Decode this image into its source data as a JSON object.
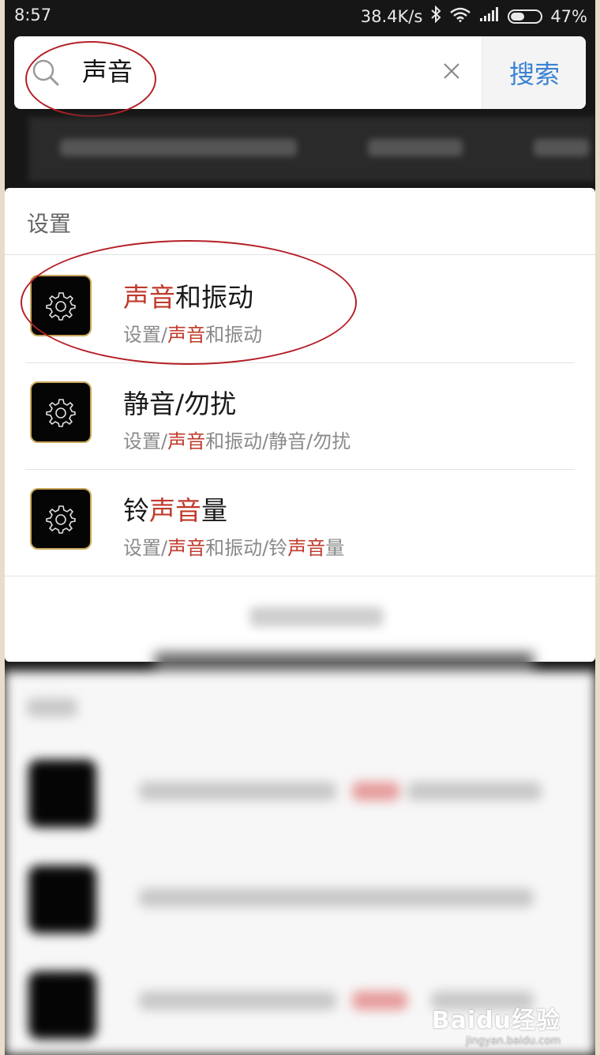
{
  "status_bar": {
    "time": "8:57",
    "network_speed": "38.4K/s",
    "battery": "47%",
    "battery_level": 0.47
  },
  "search": {
    "query": "声音",
    "button_label": "搜索"
  },
  "settings_section": {
    "header": "设置",
    "results": [
      {
        "title_parts": [
          {
            "text": "声音",
            "hl": true
          },
          {
            "text": "和振动",
            "hl": false
          }
        ],
        "path_parts": [
          {
            "text": "设置/",
            "hl": false
          },
          {
            "text": "声音",
            "hl": true
          },
          {
            "text": "和振动",
            "hl": false
          }
        ]
      },
      {
        "title_parts": [
          {
            "text": "静音/勿扰",
            "hl": false
          }
        ],
        "path_parts": [
          {
            "text": "设置/",
            "hl": false
          },
          {
            "text": "声音",
            "hl": true
          },
          {
            "text": "和振动/静音/勿扰",
            "hl": false
          }
        ]
      },
      {
        "title_parts": [
          {
            "text": "铃",
            "hl": false
          },
          {
            "text": "声音",
            "hl": true
          },
          {
            "text": "量",
            "hl": false
          }
        ],
        "path_parts": [
          {
            "text": "设置/",
            "hl": false
          },
          {
            "text": "声音",
            "hl": true
          },
          {
            "text": "和振动/铃",
            "hl": false
          },
          {
            "text": "声音",
            "hl": true
          },
          {
            "text": "量",
            "hl": false
          }
        ]
      }
    ]
  },
  "watermark": {
    "brand": "Baidu经验",
    "url": "jingyan.baidu.com"
  },
  "colors": {
    "highlight": "#c0392b",
    "accent": "#3a82d4",
    "annotation": "#b52027"
  },
  "icons": {
    "search": "search-icon",
    "clear": "close-icon",
    "app": "gear-icon"
  }
}
